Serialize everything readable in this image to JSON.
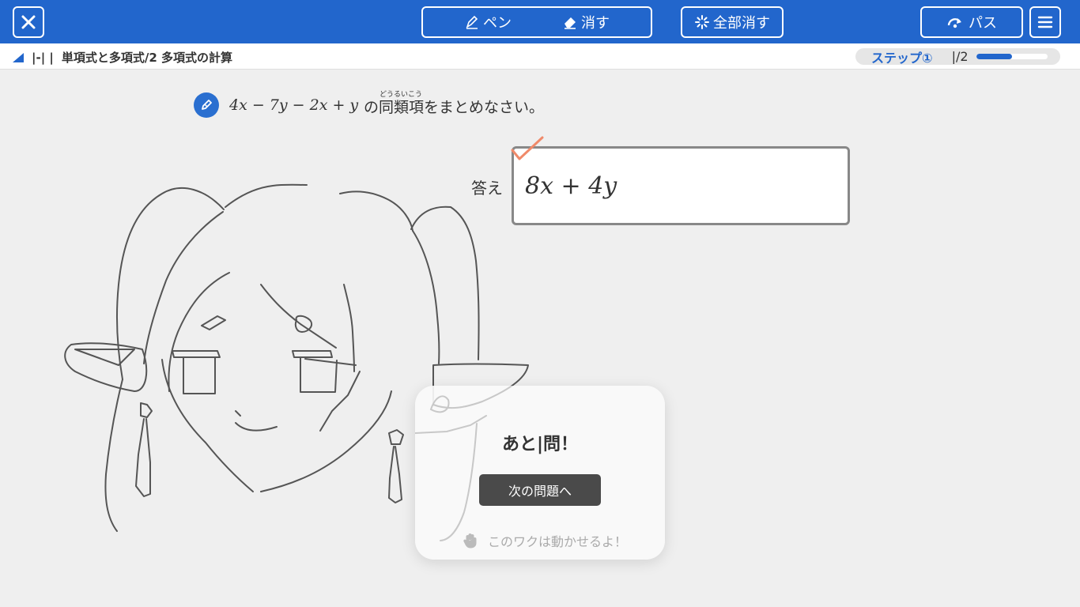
{
  "topbar": {
    "pen_label": "ペン",
    "eraser_label": "消す",
    "clear_all_label": "全部消す",
    "pass_label": "パス"
  },
  "breadcrumb": {
    "section": "|-| |",
    "title": "単項式と多項式/2 多項式の計算"
  },
  "step": {
    "label": "ステップ①",
    "count": "|/2",
    "progress": 0.5
  },
  "question": {
    "expression": "4x − 7y − 2x + y",
    "text": "の同類項をまとめなさい。",
    "ruby": "どうるいこう"
  },
  "answer": {
    "label": "答え",
    "value": "8x + 4y"
  },
  "popup": {
    "title": "あと|問！",
    "next_button": "次の問題へ",
    "hint": "このワクは動かせるよ！"
  },
  "colors": {
    "primary": "#2266cc",
    "check": "#f08a6a",
    "drawing": "#555555"
  }
}
